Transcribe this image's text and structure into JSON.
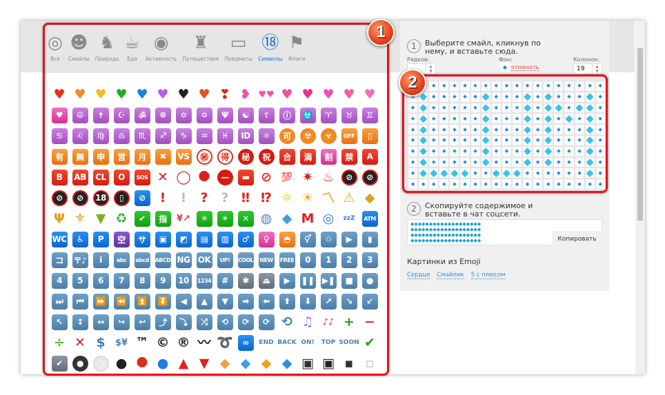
{
  "categories": [
    {
      "label": "Все",
      "icon": "◎",
      "name": "spiral-icon"
    },
    {
      "label": "Смайлы",
      "icon": "☻",
      "name": "smiley-icon"
    },
    {
      "label": "Природа",
      "icon": "♞",
      "name": "monkey-icon"
    },
    {
      "label": "Еда",
      "icon": "☕",
      "name": "food-icon"
    },
    {
      "label": "Активность",
      "icon": "◉",
      "name": "target-icon"
    },
    {
      "label": "Путешествия",
      "icon": "♜",
      "name": "castle-icon"
    },
    {
      "label": "Предметы",
      "icon": "▭",
      "name": "computer-icon"
    },
    {
      "label": "Символы",
      "icon": "⑱",
      "name": "symbols-icon",
      "active": true
    },
    {
      "label": "Флаги",
      "icon": "⚑",
      "name": "flag-icon"
    }
  ],
  "emoji_rows": [
    [
      [
        "♥",
        "#e8301c"
      ],
      [
        "♥",
        "#f08a20"
      ],
      [
        "♥",
        "#f0c020"
      ],
      [
        "♥",
        "#20b020"
      ],
      [
        "♥",
        "#1a80e0"
      ],
      [
        "♥",
        "#b060e0"
      ],
      [
        "♥",
        "#222222"
      ],
      [
        "♥",
        "#e05020"
      ],
      [
        "❣",
        "#e02020"
      ],
      [
        "❥",
        "#f050a0"
      ],
      [
        "♥♥",
        "#f050a0"
      ],
      [
        "♥",
        "#f050a0"
      ],
      [
        "♥",
        "#e83090"
      ],
      [
        "♥",
        "#f050b0"
      ],
      [
        "♥",
        "#f060a0"
      ],
      [
        "♥",
        "#f070b0"
      ]
    ],
    [
      [
        "♥",
        "pk"
      ],
      [
        "☮",
        "p"
      ],
      [
        "✝",
        "p"
      ],
      [
        "☪",
        "p"
      ],
      [
        "ॐ",
        "p"
      ],
      [
        "☸",
        "p"
      ],
      [
        "✡",
        "p"
      ],
      [
        "✡",
        "p"
      ],
      [
        "Ψ",
        "p"
      ],
      [
        "☯",
        "p"
      ],
      [
        "☦",
        "p"
      ],
      [
        "ⓘ",
        "p"
      ],
      [
        "⛎",
        "p"
      ],
      [
        "♈",
        "p"
      ],
      [
        "♉",
        "p"
      ],
      [
        "♊",
        "p"
      ]
    ],
    [
      [
        "♋",
        "p"
      ],
      [
        "♌",
        "p"
      ],
      [
        "♍",
        "p"
      ],
      [
        "♎",
        "p"
      ],
      [
        "♏",
        "p"
      ],
      [
        "♐",
        "p"
      ],
      [
        "♑",
        "p"
      ],
      [
        "♒",
        "p"
      ],
      [
        "♓",
        "p"
      ],
      [
        "ID",
        "p"
      ],
      [
        "⚛",
        "p"
      ],
      [
        "可",
        "oc"
      ],
      [
        "☢",
        "oc"
      ],
      [
        "☣",
        "oc"
      ],
      [
        "OFF",
        "o"
      ],
      [
        "▯",
        "o"
      ]
    ],
    [
      [
        "有",
        "o"
      ],
      [
        "無",
        "o"
      ],
      [
        "申",
        "o"
      ],
      [
        "営",
        "o"
      ],
      [
        "月",
        "o"
      ],
      [
        "✖",
        "o"
      ],
      [
        "VS",
        "o"
      ],
      [
        "㊙",
        "ro"
      ],
      [
        "得",
        "ro"
      ],
      [
        "秘",
        "rc"
      ],
      [
        "祝",
        "rc"
      ],
      [
        "合",
        "r"
      ],
      [
        "満",
        "r"
      ],
      [
        "割",
        "pk"
      ],
      [
        "禁",
        "r"
      ],
      [
        "A",
        "r"
      ]
    ],
    [
      [
        "B",
        "r"
      ],
      [
        "AB",
        "r"
      ],
      [
        "CL",
        "r"
      ],
      [
        "O",
        "r"
      ],
      [
        "SOS",
        "r"
      ],
      [
        "✕",
        "#e02020"
      ],
      [
        "◯",
        "#e02020"
      ],
      [
        "⯃",
        "#d82020"
      ],
      [
        "—",
        "rc"
      ],
      [
        "▬",
        "r"
      ],
      [
        "⊘",
        "#e03020"
      ],
      [
        "💯",
        "#e02020"
      ],
      [
        "✷",
        "#e02020"
      ],
      [
        "♨",
        "#e03020"
      ],
      [
        "⊘",
        "k"
      ],
      [
        "⊘",
        "k"
      ]
    ],
    [
      [
        "⊘",
        "k"
      ],
      [
        "⊘",
        "k"
      ],
      [
        "18",
        "k"
      ],
      [
        "▯",
        "k"
      ],
      [
        "⊘",
        "b"
      ],
      [
        "!",
        "#e02020"
      ],
      [
        "!",
        "#bbbbbb"
      ],
      [
        "?",
        "#e02020"
      ],
      [
        "?",
        "#bbbbbb"
      ],
      [
        "‼",
        "#e02020"
      ],
      [
        "⁉",
        "#e02020"
      ],
      [
        "☼",
        "#f0c020"
      ],
      [
        "☀",
        "#f0b010"
      ],
      [
        "〽",
        "#f0a010"
      ],
      [
        "⚠",
        "#f0b010"
      ],
      [
        "◆",
        "#e0a020"
      ]
    ],
    [
      [
        "Ψ",
        "#e0a020"
      ],
      [
        "⚜",
        "#e0a020"
      ],
      [
        "▼",
        "#80b020"
      ],
      [
        "♻",
        "#40b040"
      ],
      [
        "✔",
        "g"
      ],
      [
        "指",
        "g"
      ],
      [
        "¥↗",
        "#d04040"
      ],
      [
        "✳",
        "g"
      ],
      [
        "✴",
        "g"
      ],
      [
        "✕",
        "g"
      ],
      [
        "◍",
        "#4a80c0"
      ],
      [
        "◆",
        "#40a0e0"
      ],
      [
        "M",
        "#e02020"
      ],
      [
        "◎",
        "#2a80e0"
      ],
      [
        "zzZ",
        "#2a80e0"
      ],
      [
        "ATM",
        "b"
      ]
    ],
    [
      [
        "WC",
        "b"
      ],
      [
        "♿",
        "b"
      ],
      [
        "P",
        "b"
      ],
      [
        "空",
        "v"
      ],
      [
        "サ",
        "b"
      ],
      [
        "▣",
        "b"
      ],
      [
        "◩",
        "b"
      ],
      [
        "▤",
        "b"
      ],
      [
        "▥",
        "b"
      ],
      [
        "♂",
        "b"
      ],
      [
        "♀",
        "pk"
      ],
      [
        "◓",
        "o"
      ],
      [
        "⚥",
        "s"
      ],
      [
        "♲",
        "s"
      ],
      [
        "▶",
        "s"
      ],
      [
        "▮",
        "s"
      ]
    ],
    [
      [
        "コ",
        "s"
      ],
      [
        "〒♪",
        "s"
      ],
      [
        "i",
        "s"
      ],
      [
        "abc",
        "s"
      ],
      [
        "abcd",
        "s"
      ],
      [
        "ABCD",
        "s"
      ],
      [
        "NG",
        "s"
      ],
      [
        "OK",
        "s"
      ],
      [
        "UP!",
        "s"
      ],
      [
        "COOL",
        "s"
      ],
      [
        "NEW",
        "s"
      ],
      [
        "FREE",
        "s"
      ],
      [
        "0",
        "s"
      ],
      [
        "1",
        "s"
      ],
      [
        "2",
        "s"
      ],
      [
        "3",
        "s"
      ]
    ],
    [
      [
        "4",
        "s"
      ],
      [
        "5",
        "s"
      ],
      [
        "6",
        "s"
      ],
      [
        "7",
        "s"
      ],
      [
        "8",
        "s"
      ],
      [
        "9",
        "s"
      ],
      [
        "10",
        "s"
      ],
      [
        "1234",
        "s"
      ],
      [
        "#",
        "s"
      ],
      [
        "✱",
        "gy"
      ],
      [
        "⏏",
        "gy"
      ],
      [
        "▶",
        "s"
      ],
      [
        "❚❚",
        "s"
      ],
      [
        "▶❚",
        "s"
      ],
      [
        "■",
        "s"
      ],
      [
        "●",
        "s"
      ]
    ],
    [
      [
        "⏭",
        "s"
      ],
      [
        "⏮",
        "s"
      ],
      [
        "⏩",
        "s"
      ],
      [
        "⏪",
        "s"
      ],
      [
        "⏫",
        "s"
      ],
      [
        "⏬",
        "s"
      ],
      [
        "◀",
        "s"
      ],
      [
        "▲",
        "s"
      ],
      [
        "▼",
        "s"
      ],
      [
        "➡",
        "s"
      ],
      [
        "⬅",
        "s"
      ],
      [
        "⬆",
        "s"
      ],
      [
        "⬇",
        "s"
      ],
      [
        "↗",
        "s"
      ],
      [
        "↘",
        "s"
      ],
      [
        "↙",
        "s"
      ]
    ],
    [
      [
        "↖",
        "s"
      ],
      [
        "↕",
        "s"
      ],
      [
        "↔",
        "s"
      ],
      [
        "↪",
        "s"
      ],
      [
        "↩",
        "s"
      ],
      [
        "⤴",
        "s"
      ],
      [
        "⤵",
        "s"
      ],
      [
        "⤮",
        "s"
      ],
      [
        "⟲",
        "s"
      ],
      [
        "⟳",
        "s"
      ],
      [
        "⟳",
        "s"
      ],
      [
        "⟲",
        "#4a80b0"
      ],
      [
        "♫",
        "#a070e0"
      ],
      [
        "♪♪",
        "#e03030"
      ],
      [
        "+",
        "#30a020"
      ],
      [
        "−",
        "#e03030"
      ]
    ],
    [
      [
        "÷",
        "#60b020"
      ],
      [
        "✕",
        "#e02020"
      ],
      [
        "$",
        "#4a80b0"
      ],
      [
        "$¥",
        "#4a80b0"
      ],
      [
        "™",
        "#222222"
      ],
      [
        "©",
        "#222222"
      ],
      [
        "®",
        "#222222"
      ],
      [
        "〰",
        "#222222"
      ],
      [
        "➰",
        "#4a80b0"
      ],
      [
        "∞",
        "b"
      ],
      [
        "END",
        "#4a80b0"
      ],
      [
        "BACK",
        "#4a80b0"
      ],
      [
        "ON!",
        "#4a80b0"
      ],
      [
        "TOP",
        "#4a80b0"
      ],
      [
        "SOON",
        "#4a80b0"
      ],
      [
        "✔",
        "#30a020"
      ]
    ],
    [
      [
        "✔",
        "gy"
      ],
      [
        "●",
        "bk"
      ],
      [
        "○",
        "lt"
      ],
      [
        "●",
        "#222222"
      ],
      [
        "⯃",
        "#d83020"
      ],
      [
        "●",
        "#1a7de0"
      ],
      [
        "▲",
        "#e02020"
      ],
      [
        "▼",
        "#e02020"
      ],
      [
        "◆",
        "#f0a040"
      ],
      [
        "◆",
        "#40a0e0"
      ],
      [
        "◆",
        "#f0a020"
      ],
      [
        "◆",
        "#2a90e0"
      ],
      [
        "▣",
        "#333333"
      ],
      [
        "▣",
        "#222222"
      ],
      [
        "▪",
        "#333333"
      ],
      [
        "▫",
        "#bbbbbb"
      ]
    ]
  ],
  "step1": {
    "num": "1",
    "text": "Выберите смайл, кликнув по нему, и вставьте сюда."
  },
  "rows_label": "Рядков:",
  "bg_label": "Фон:",
  "bg_cancel": "отменить",
  "bg_glyph": "◆",
  "cols_label": "Колонок:",
  "cols_value": "19",
  "board": {
    "small": "◆",
    "big": "◆",
    "pattern": [
      "...................",
      ".X.....X...X.X...X.",
      ".X.....X...X.XX.XX.",
      ".X.....X...X.X.X.X.",
      ".X.....X...X.X...X.",
      ".X.....X...X.X...X.",
      ".X.....X...X.X...X.",
      ".X.....X...X.X...X.",
      ".XXXXX..XXX......X.",
      "..................."
    ]
  },
  "step2": {
    "num": "2",
    "text": "Скопируйте содержимое и вставьте в чат соцсети."
  },
  "copy_label": "Копировать",
  "pics_title": "Картинки из Emoji",
  "links": [
    "Сердце",
    "Смайлик",
    "5 с плюсом"
  ],
  "badges": [
    "1",
    "2"
  ],
  "accent": "#e8101a"
}
